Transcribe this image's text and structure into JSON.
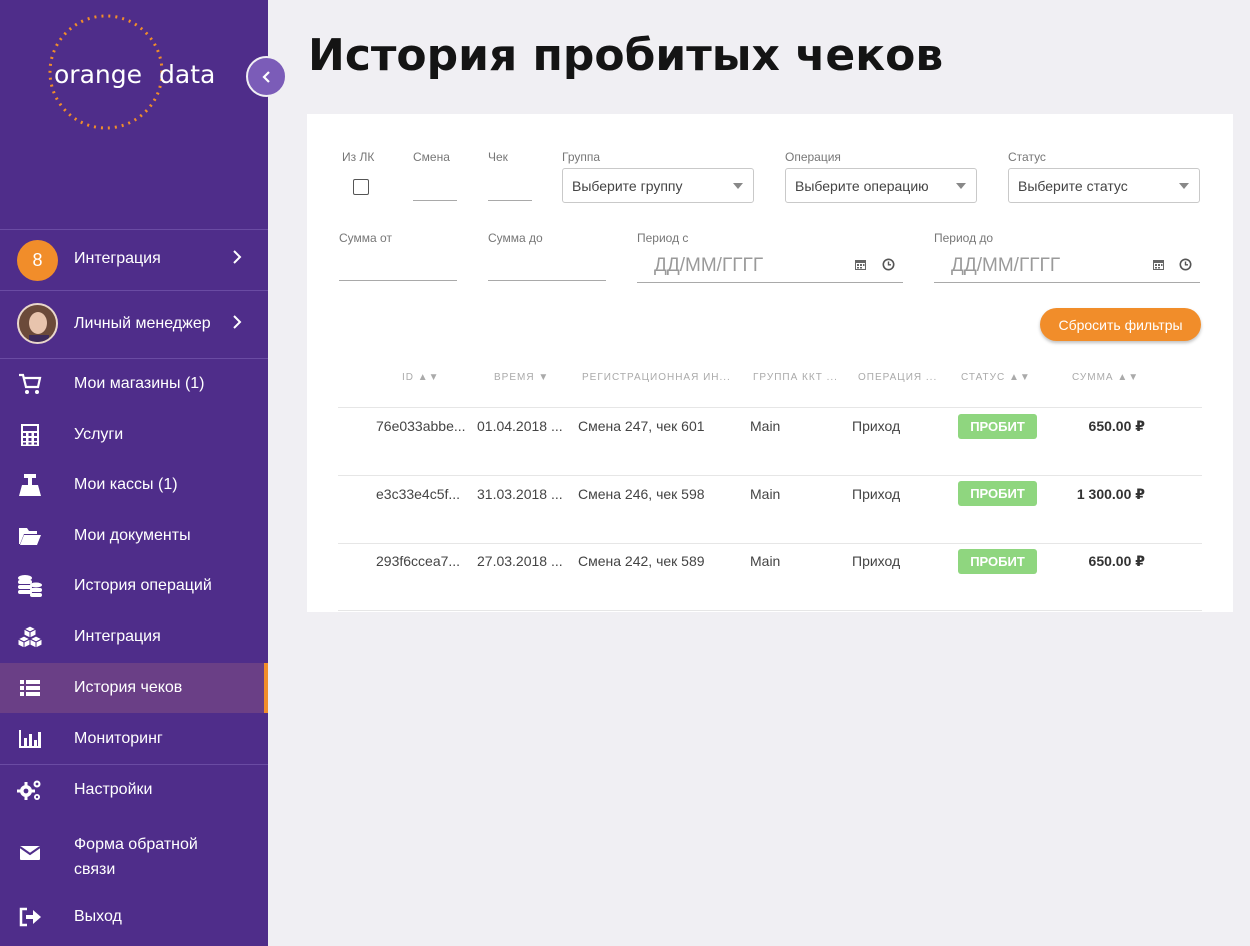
{
  "logo": {
    "left": "orange",
    "right": "data"
  },
  "sidebar": {
    "top_items": [
      {
        "badge": "8",
        "label": "Интеграция",
        "icon": "chevron-right-icon"
      },
      {
        "label": "Личный менеджер",
        "icon": "chevron-right-icon"
      }
    ],
    "items": [
      {
        "label": "Мои магазины (1)",
        "icon": "cart-icon"
      },
      {
        "label": "Услуги",
        "icon": "calculator-icon"
      },
      {
        "label": "Мои кассы (1)",
        "icon": "register-icon"
      },
      {
        "label": "Мои документы",
        "icon": "folder-icon"
      },
      {
        "label": "История операций",
        "icon": "database-icon"
      },
      {
        "label": "Интеграция",
        "icon": "cubes-icon"
      },
      {
        "label": "История чеков",
        "icon": "list-icon",
        "active": true
      },
      {
        "label": "Мониторинг",
        "icon": "bar-chart-icon"
      },
      {
        "label": "Настройки",
        "icon": "gears-icon"
      },
      {
        "label": "Форма обратной связи",
        "label_line1": "Форма обратной",
        "label_line2": "связи",
        "icon": "envelope-icon"
      },
      {
        "label": "Выход",
        "icon": "sign-out-icon"
      }
    ]
  },
  "page": {
    "title": "История пробитых чеков"
  },
  "filters": {
    "from_lk": "Из ЛК",
    "shift": "Смена",
    "check": "Чек",
    "group": {
      "label": "Группа",
      "placeholder": "Выберите группу"
    },
    "operation": {
      "label": "Операция",
      "placeholder": "Выберите операцию"
    },
    "status": {
      "label": "Статус",
      "placeholder": "Выберите статус"
    },
    "sum_from": "Сумма от",
    "sum_to": "Сумма до",
    "period_from": {
      "label": "Период с",
      "placeholder": "ДД/ММ/ГГГГ"
    },
    "period_to": {
      "label": "Период до",
      "placeholder": "ДД/ММ/ГГГГ"
    },
    "reset_label": "Сбросить фильтры"
  },
  "table": {
    "headers": [
      "ID ▲▼",
      "ВРЕМЯ ▼",
      "РЕГИСТРАЦИОННАЯ ИН...",
      "ГРУППА ККТ ...",
      "ОПЕРАЦИЯ ...",
      "СТАТУС ▲▼",
      "СУММА ▲▼"
    ],
    "rows": [
      {
        "id": "76e033abbe...",
        "time": "01.04.2018 ...",
        "reg": "Смена 247, чек 601",
        "group": "Main",
        "operation": "Приход",
        "status": "ПРОБИТ",
        "sum": "650.00 ₽"
      },
      {
        "id": "e3c33e4c5f...",
        "time": "31.03.2018 ...",
        "reg": "Смена 246, чек 598",
        "group": "Main",
        "operation": "Приход",
        "status": "ПРОБИТ",
        "sum": "1 300.00 ₽"
      },
      {
        "id": "293f6ccea7...",
        "time": "27.03.2018 ...",
        "reg": "Смена 242, чек 589",
        "group": "Main",
        "operation": "Приход",
        "status": "ПРОБИТ",
        "sum": "650.00 ₽"
      }
    ]
  },
  "colors": {
    "sidebar": "#4f2d8a",
    "accent": "#f18d2a",
    "status_ok": "#8fd67f"
  }
}
